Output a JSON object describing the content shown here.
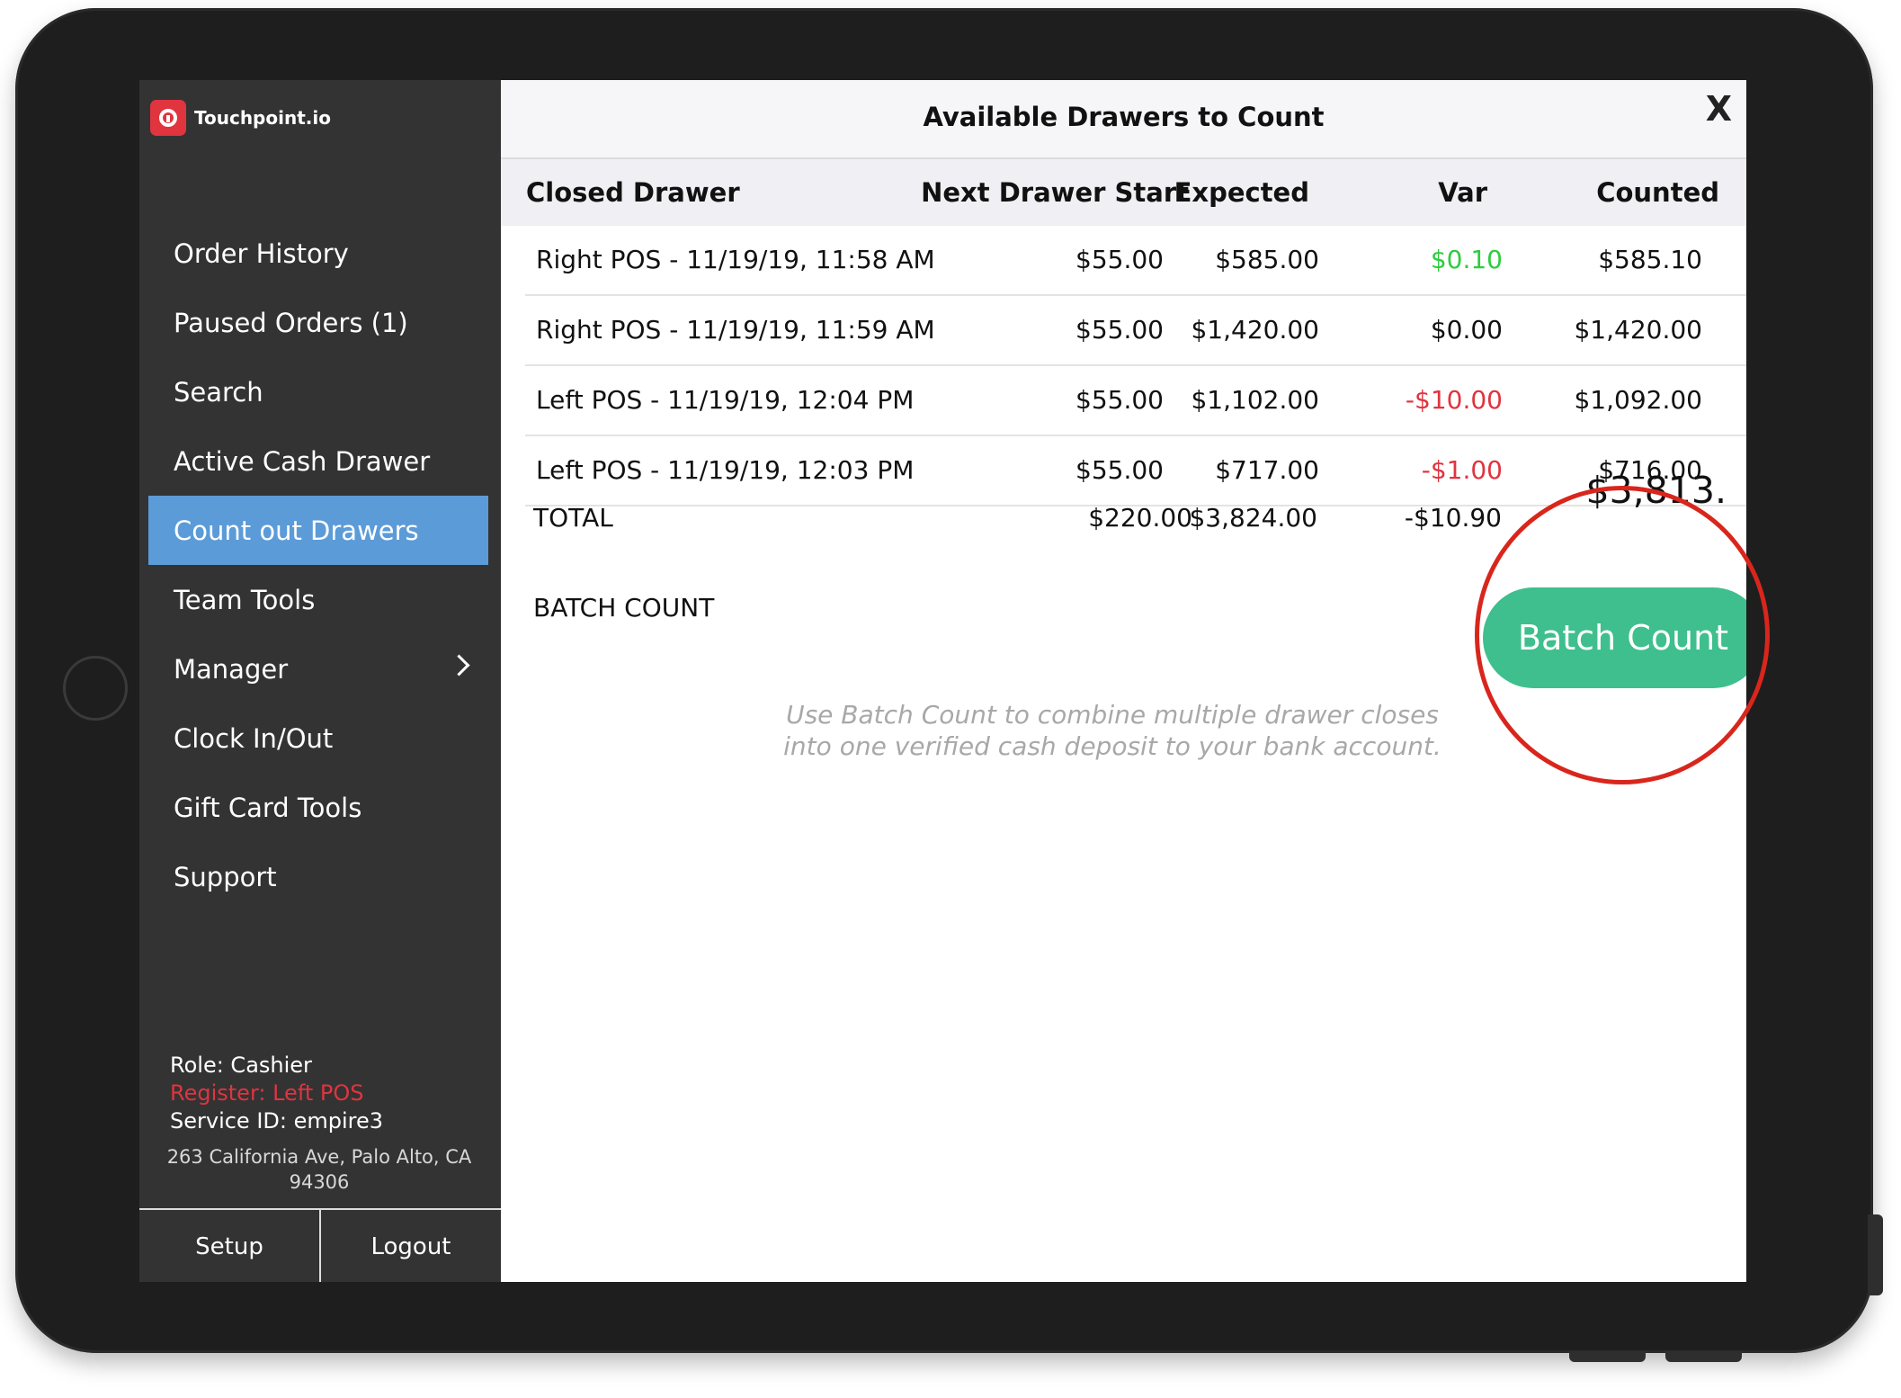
{
  "app": {
    "name": "Touchpoint.io"
  },
  "sidebar": {
    "items": [
      {
        "label": "Order History"
      },
      {
        "label": "Paused Orders (1)"
      },
      {
        "label": "Search"
      },
      {
        "label": "Active Cash Drawer"
      },
      {
        "label": "Count out Drawers",
        "active": true
      },
      {
        "label": "Team Tools"
      },
      {
        "label": "Manager"
      },
      {
        "label": "Clock In/Out"
      },
      {
        "label": "Gift Card Tools"
      },
      {
        "label": "Support"
      }
    ],
    "role": "Role: Cashier",
    "register": "Register: Left POS",
    "service_id": "Service ID: empire3",
    "address": "263 California Ave, Palo Alto, CA 94306",
    "setup_label": "Setup",
    "logout_label": "Logout"
  },
  "modal": {
    "title": "Available Drawers to Count",
    "close_label": "X",
    "columns": [
      "Closed Drawer",
      "Next Drawer Start",
      "Expected",
      "Var",
      "Counted"
    ],
    "rows": [
      [
        "Right POS - 11/19/19, 11:58 AM",
        "$55.00",
        "$585.00",
        "$0.10",
        "$585.10"
      ],
      [
        "Right POS - 11/19/19, 11:59 AM",
        "$55.00",
        "$1,420.00",
        "$0.00",
        "$1,420.00"
      ],
      [
        "Left POS - 11/19/19, 12:04 PM",
        "$55.00",
        "$1,102.00",
        "-$10.00",
        "$1,092.00"
      ],
      [
        "Left POS - 11/19/19, 12:03 PM",
        "$55.00",
        "$717.00",
        "-$1.00",
        "$716.00"
      ]
    ],
    "total": {
      "label": "TOTAL",
      "next_start": "$220.00",
      "expected": "$3,824.00",
      "var": "-$10.90",
      "counted": "$3,813."
    },
    "batch_count_label": "BATCH COUNT",
    "batch_button": "Batch Count",
    "hint": "Use Batch Count to combine multiple drawer closes into one verified cash deposit to your bank account."
  },
  "colors": {
    "accent": "#5b9bd8",
    "button": "#3fbf8d",
    "positive": "#2ecc40",
    "negative": "#e0343f",
    "highlight": "#d9261c"
  }
}
